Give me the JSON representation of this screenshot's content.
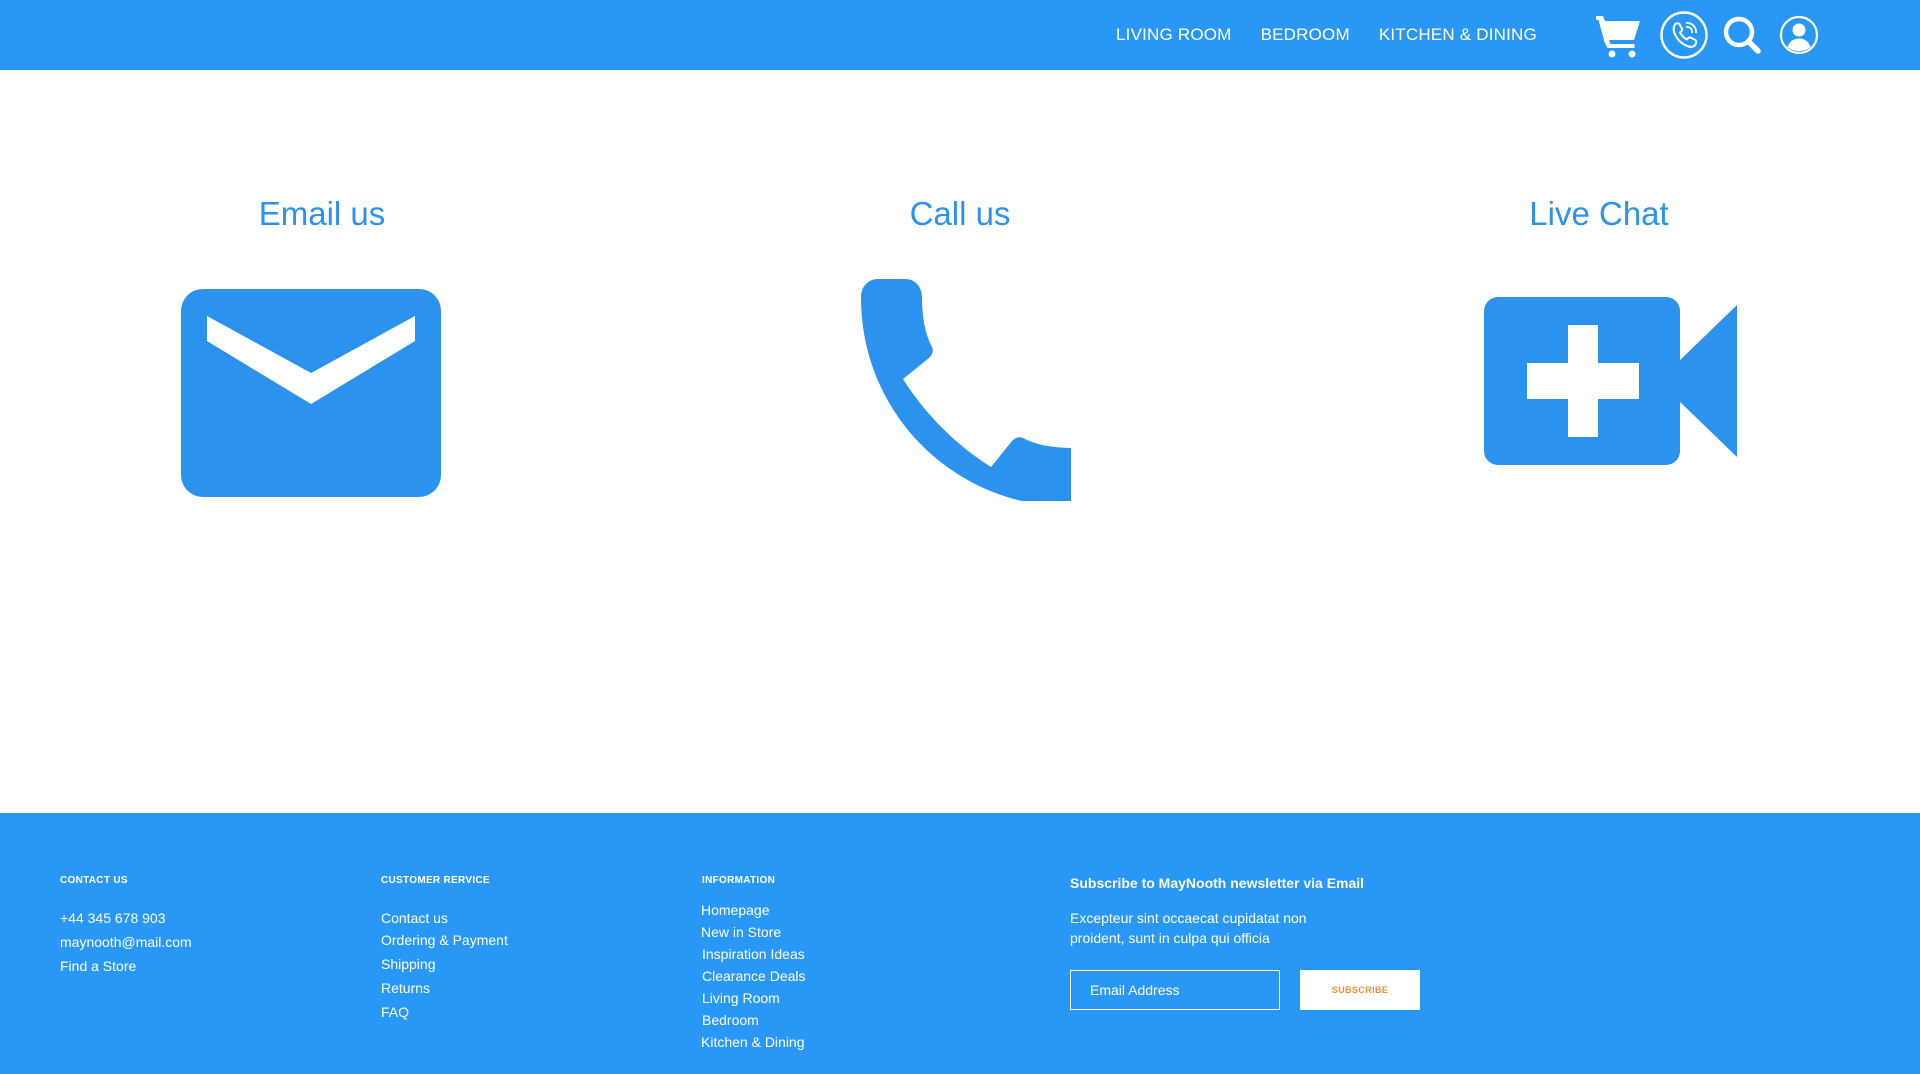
{
  "header": {
    "nav": [
      {
        "label": "LIVING ROOM"
      },
      {
        "label": "BEDROOM"
      },
      {
        "label": "KITCHEN & DINING"
      }
    ],
    "icons": [
      "cart-icon",
      "phone-circle-icon",
      "search-icon",
      "user-icon"
    ]
  },
  "options": [
    {
      "title": "Email us",
      "icon": "envelope-icon"
    },
    {
      "title": "Call us",
      "icon": "phone-icon"
    },
    {
      "title": "Live Chat",
      "icon": "video-add-icon"
    }
  ],
  "footer": {
    "contact": {
      "heading": "CONTACT US",
      "items": [
        "+44 345 678 903",
        "maynooth@mail.com",
        "Find a Store"
      ]
    },
    "service": {
      "heading": "CUSTOMER RERVICE",
      "items": [
        "Contact us",
        "Ordering & Payment",
        "Shipping",
        "Returns",
        "FAQ"
      ]
    },
    "info": {
      "heading": "INFORMATION",
      "items": [
        "Homepage",
        "New in Store",
        "Inspiration Ideas",
        "Clearance Deals",
        "Living Room",
        "Bedroom",
        "Kitchen & Dining"
      ]
    },
    "newsletter": {
      "title": "Subscribe to MayNooth newsletter via Email",
      "text": "Excepteur sint occaecat cupidatat non proident, sunt in culpa qui officia",
      "placeholder": "Email Address",
      "button": "SUBSCRIBE"
    }
  },
  "colors": {
    "brand_blue": "#2997f5",
    "icon_blue": "#2b93ee",
    "button_text": "#e8903a"
  }
}
